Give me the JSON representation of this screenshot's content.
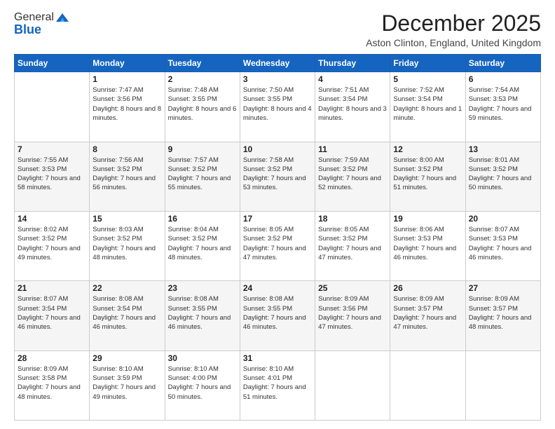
{
  "logo": {
    "general": "General",
    "blue": "Blue"
  },
  "title": "December 2025",
  "location": "Aston Clinton, England, United Kingdom",
  "weekdays": [
    "Sunday",
    "Monday",
    "Tuesday",
    "Wednesday",
    "Thursday",
    "Friday",
    "Saturday"
  ],
  "weeks": [
    [
      {
        "day": null
      },
      {
        "day": 1,
        "sunrise": "7:47 AM",
        "sunset": "3:56 PM",
        "daylight": "8 hours and 8 minutes."
      },
      {
        "day": 2,
        "sunrise": "7:48 AM",
        "sunset": "3:55 PM",
        "daylight": "8 hours and 6 minutes."
      },
      {
        "day": 3,
        "sunrise": "7:50 AM",
        "sunset": "3:55 PM",
        "daylight": "8 hours and 4 minutes."
      },
      {
        "day": 4,
        "sunrise": "7:51 AM",
        "sunset": "3:54 PM",
        "daylight": "8 hours and 3 minutes."
      },
      {
        "day": 5,
        "sunrise": "7:52 AM",
        "sunset": "3:54 PM",
        "daylight": "8 hours and 1 minute."
      },
      {
        "day": 6,
        "sunrise": "7:54 AM",
        "sunset": "3:53 PM",
        "daylight": "7 hours and 59 minutes."
      }
    ],
    [
      {
        "day": 7,
        "sunrise": "7:55 AM",
        "sunset": "3:53 PM",
        "daylight": "7 hours and 58 minutes."
      },
      {
        "day": 8,
        "sunrise": "7:56 AM",
        "sunset": "3:52 PM",
        "daylight": "7 hours and 56 minutes."
      },
      {
        "day": 9,
        "sunrise": "7:57 AM",
        "sunset": "3:52 PM",
        "daylight": "7 hours and 55 minutes."
      },
      {
        "day": 10,
        "sunrise": "7:58 AM",
        "sunset": "3:52 PM",
        "daylight": "7 hours and 53 minutes."
      },
      {
        "day": 11,
        "sunrise": "7:59 AM",
        "sunset": "3:52 PM",
        "daylight": "7 hours and 52 minutes."
      },
      {
        "day": 12,
        "sunrise": "8:00 AM",
        "sunset": "3:52 PM",
        "daylight": "7 hours and 51 minutes."
      },
      {
        "day": 13,
        "sunrise": "8:01 AM",
        "sunset": "3:52 PM",
        "daylight": "7 hours and 50 minutes."
      }
    ],
    [
      {
        "day": 14,
        "sunrise": "8:02 AM",
        "sunset": "3:52 PM",
        "daylight": "7 hours and 49 minutes."
      },
      {
        "day": 15,
        "sunrise": "8:03 AM",
        "sunset": "3:52 PM",
        "daylight": "7 hours and 48 minutes."
      },
      {
        "day": 16,
        "sunrise": "8:04 AM",
        "sunset": "3:52 PM",
        "daylight": "7 hours and 48 minutes."
      },
      {
        "day": 17,
        "sunrise": "8:05 AM",
        "sunset": "3:52 PM",
        "daylight": "7 hours and 47 minutes."
      },
      {
        "day": 18,
        "sunrise": "8:05 AM",
        "sunset": "3:52 PM",
        "daylight": "7 hours and 47 minutes."
      },
      {
        "day": 19,
        "sunrise": "8:06 AM",
        "sunset": "3:53 PM",
        "daylight": "7 hours and 46 minutes."
      },
      {
        "day": 20,
        "sunrise": "8:07 AM",
        "sunset": "3:53 PM",
        "daylight": "7 hours and 46 minutes."
      }
    ],
    [
      {
        "day": 21,
        "sunrise": "8:07 AM",
        "sunset": "3:54 PM",
        "daylight": "7 hours and 46 minutes."
      },
      {
        "day": 22,
        "sunrise": "8:08 AM",
        "sunset": "3:54 PM",
        "daylight": "7 hours and 46 minutes."
      },
      {
        "day": 23,
        "sunrise": "8:08 AM",
        "sunset": "3:55 PM",
        "daylight": "7 hours and 46 minutes."
      },
      {
        "day": 24,
        "sunrise": "8:08 AM",
        "sunset": "3:55 PM",
        "daylight": "7 hours and 46 minutes."
      },
      {
        "day": 25,
        "sunrise": "8:09 AM",
        "sunset": "3:56 PM",
        "daylight": "7 hours and 47 minutes."
      },
      {
        "day": 26,
        "sunrise": "8:09 AM",
        "sunset": "3:57 PM",
        "daylight": "7 hours and 47 minutes."
      },
      {
        "day": 27,
        "sunrise": "8:09 AM",
        "sunset": "3:57 PM",
        "daylight": "7 hours and 48 minutes."
      }
    ],
    [
      {
        "day": 28,
        "sunrise": "8:09 AM",
        "sunset": "3:58 PM",
        "daylight": "7 hours and 48 minutes."
      },
      {
        "day": 29,
        "sunrise": "8:10 AM",
        "sunset": "3:59 PM",
        "daylight": "7 hours and 49 minutes."
      },
      {
        "day": 30,
        "sunrise": "8:10 AM",
        "sunset": "4:00 PM",
        "daylight": "7 hours and 50 minutes."
      },
      {
        "day": 31,
        "sunrise": "8:10 AM",
        "sunset": "4:01 PM",
        "daylight": "7 hours and 51 minutes."
      },
      {
        "day": null
      },
      {
        "day": null
      },
      {
        "day": null
      }
    ]
  ],
  "labels": {
    "sunrise": "Sunrise:",
    "sunset": "Sunset:",
    "daylight": "Daylight:"
  }
}
